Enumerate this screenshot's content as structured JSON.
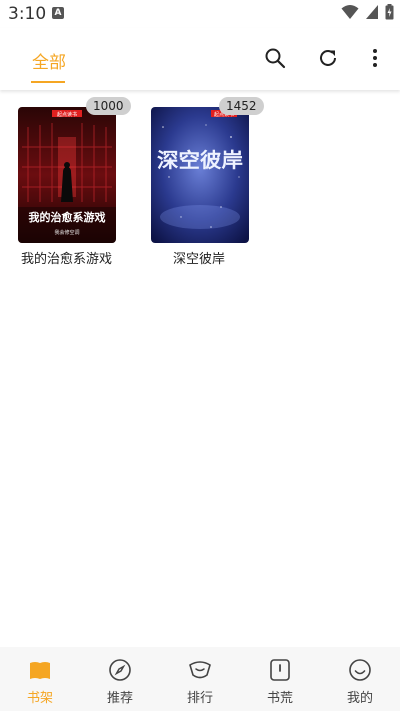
{
  "status": {
    "time": "3:10",
    "indicator": "A"
  },
  "topbar": {
    "tab_label": "全部",
    "accent": "#f5a623",
    "icons": [
      "search-icon",
      "refresh-icon",
      "more-vertical-icon"
    ]
  },
  "books": [
    {
      "title": "我的治愈系游戏",
      "badge": "1000",
      "cover_title": "我的治愈系游戏",
      "cover_brand": "起点读书",
      "cover_author": "我会修空调"
    },
    {
      "title": "深空彼岸",
      "badge": "1452",
      "cover_title": "深空彼岸",
      "cover_brand": "起点读书"
    }
  ],
  "bottom_nav": [
    {
      "label": "书架",
      "icon": "bookshelf-icon",
      "active": true
    },
    {
      "label": "推荐",
      "icon": "compass-icon",
      "active": false
    },
    {
      "label": "排行",
      "icon": "ranking-icon",
      "active": false
    },
    {
      "label": "书荒",
      "icon": "book-shortage-icon",
      "active": false
    },
    {
      "label": "我的",
      "icon": "smile-icon",
      "active": false
    }
  ]
}
